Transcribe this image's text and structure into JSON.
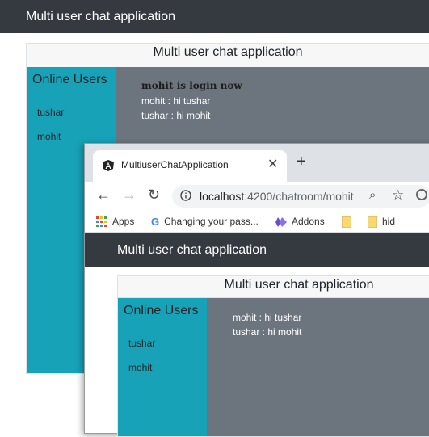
{
  "outer": {
    "navbar_brand": "Multi user chat application",
    "card_header": "Multi user chat application",
    "sidebar_title": "Online Users",
    "users": [
      "tushar",
      "mohit"
    ],
    "login_notice": "mohit is login now",
    "messages": [
      "mohit : hi tushar",
      "tushar : hi mohit"
    ]
  },
  "browser": {
    "tab_title": "MultiuserChatApplication",
    "url_host": "localhost",
    "url_rest": ":4200/chatroom/mohit",
    "bookmarks": [
      "Apps",
      "Changing your pass...",
      "Addons",
      "",
      "hid"
    ]
  },
  "inner": {
    "navbar_brand": "Multi user chat application",
    "card_header": "Multi user chat application",
    "sidebar_title": "Online Users",
    "users": [
      "tushar",
      "mohit"
    ],
    "messages": [
      "mohit : hi tushar",
      "tushar : hi mohit"
    ]
  },
  "colors": {
    "navbar": "#343a40",
    "sidebar": "#17a2b8",
    "chat_bg": "#6c757d"
  }
}
